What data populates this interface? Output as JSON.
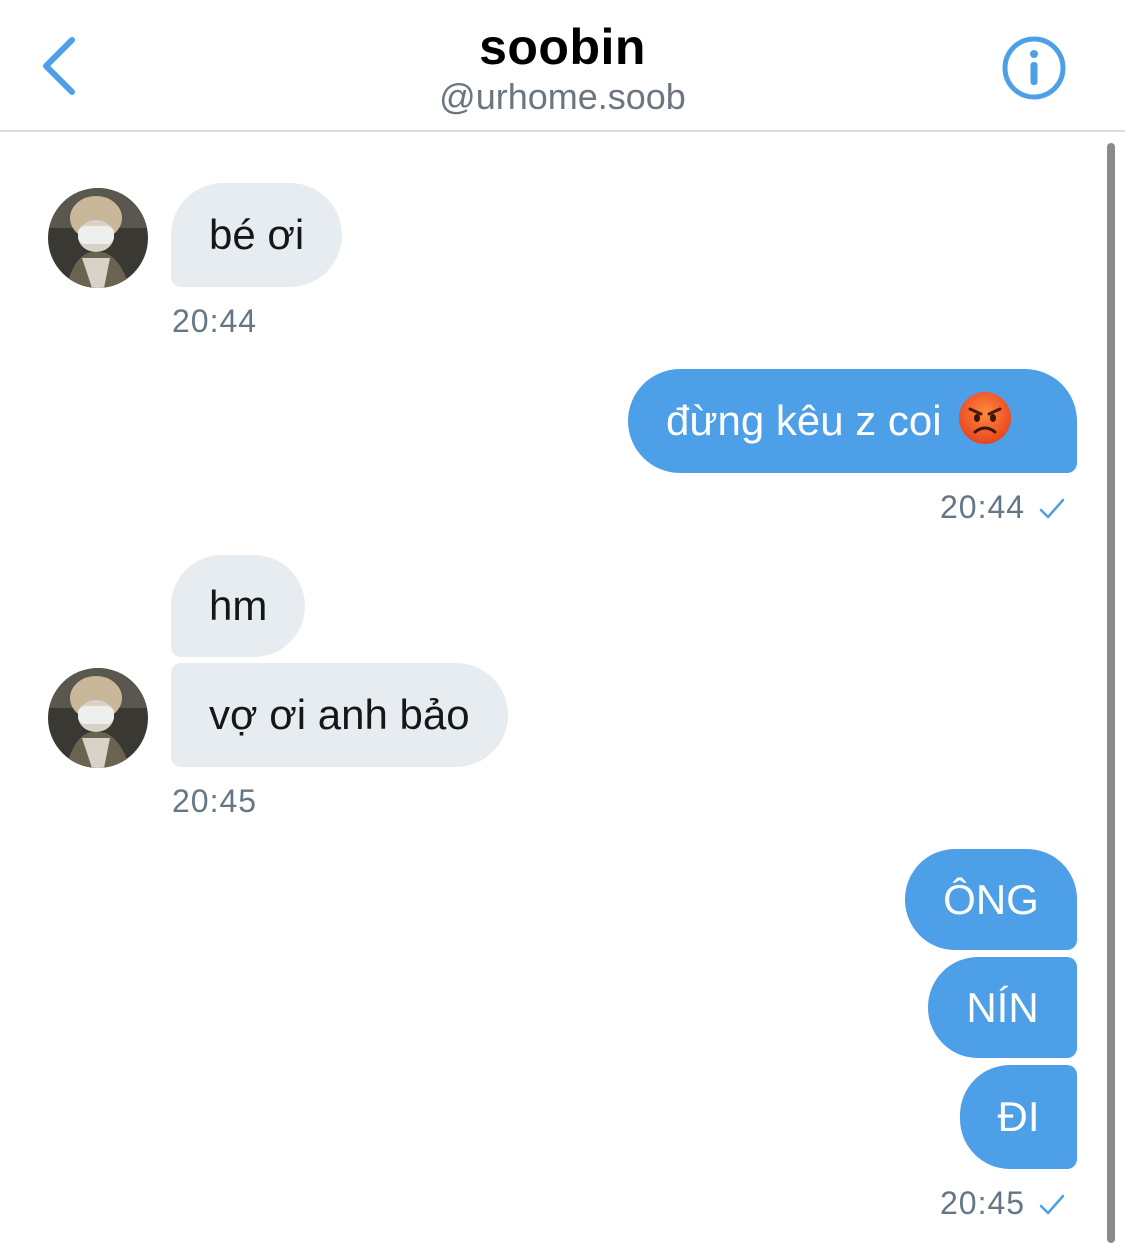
{
  "header": {
    "title": "soobin",
    "handle": "@urhome.soob"
  },
  "colors": {
    "accent": "#4d9fe8",
    "incoming_bubble": "#e6ecf0",
    "timestamp": "#657786"
  },
  "icons": {
    "back": "chevron-left-icon",
    "info": "info-circle-icon",
    "read": "checkmark-icon",
    "emoji": "angry-face-emoji"
  },
  "messages": [
    {
      "direction": "incoming",
      "text": "bé ơi"
    },
    {
      "direction": "outgoing",
      "text": "đừng kêu z coi"
    },
    {
      "direction": "incoming",
      "text": "hm"
    },
    {
      "direction": "incoming",
      "text": "vợ ơi anh bảo"
    },
    {
      "direction": "outgoing",
      "text": "ÔNG"
    },
    {
      "direction": "outgoing",
      "text": "NÍN"
    },
    {
      "direction": "outgoing",
      "text": "ĐI"
    }
  ],
  "timestamps": [
    "20:44",
    "20:44",
    "20:45",
    "20:45"
  ]
}
